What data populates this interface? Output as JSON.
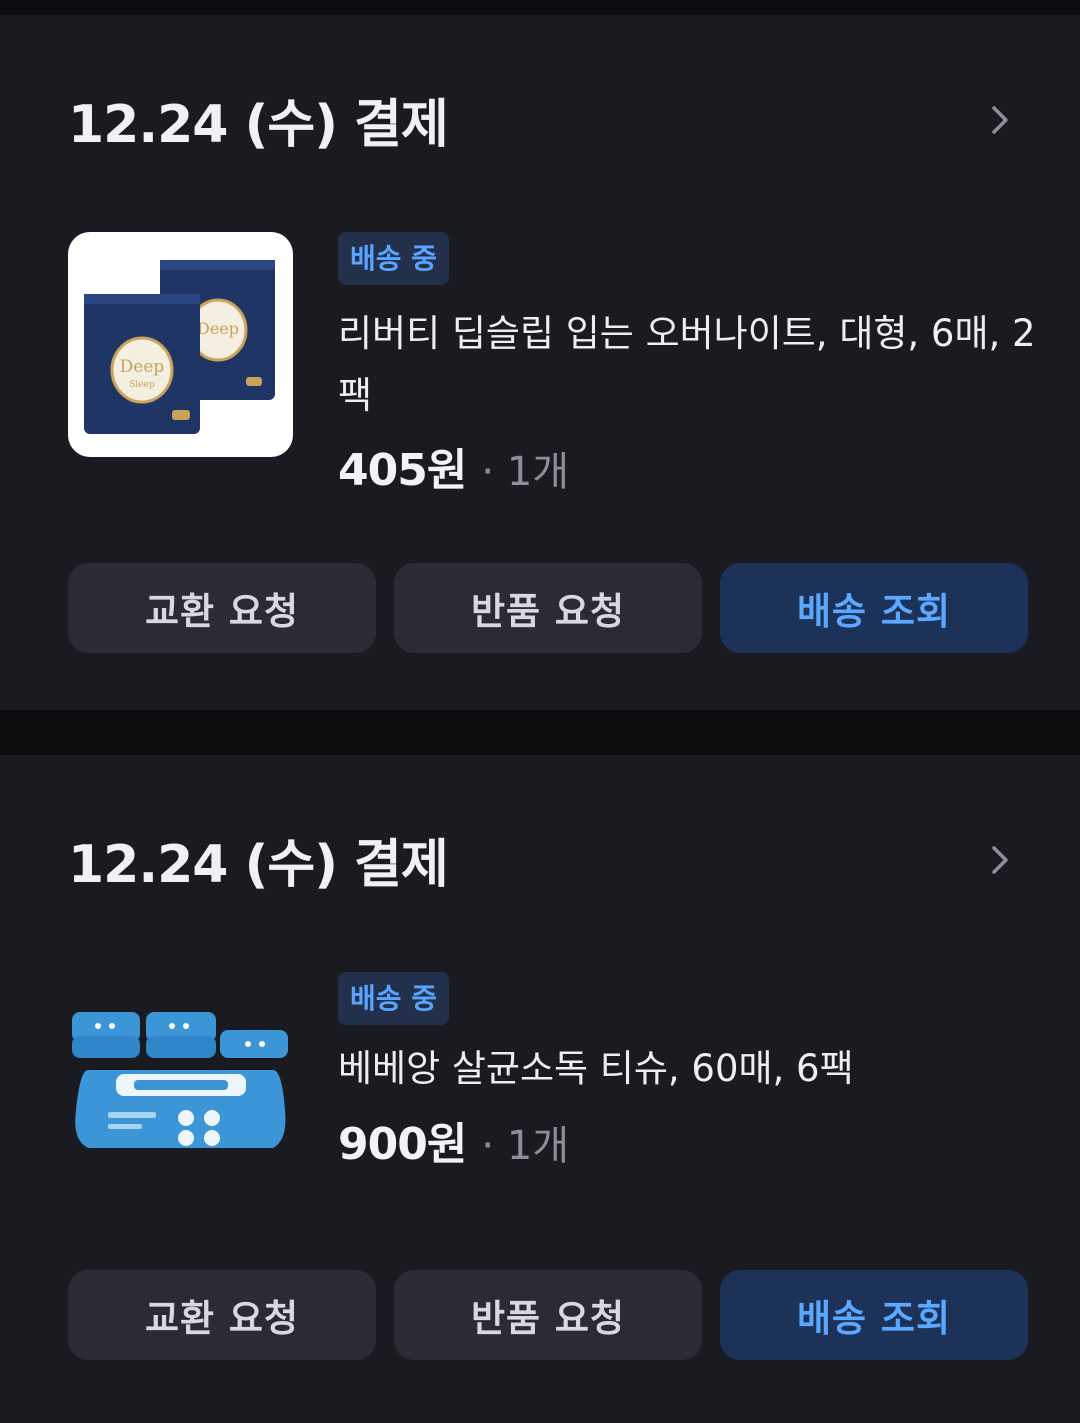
{
  "orders": [
    {
      "date": "12.24 (수) 결제",
      "status": "배송 중",
      "product_name": "리버티 딥슬립 입는 오버나이트, 대형, 6매, 2팩",
      "price": "405원",
      "quantity": "· 1개",
      "buttons": {
        "exchange": "교환 요청",
        "return": "반품 요청",
        "track": "배송 조회"
      },
      "image_icon": "pad-package-image"
    },
    {
      "date": "12.24 (수) 결제",
      "status": "배송 중",
      "product_name": "베베앙 살균소독 티슈, 60매, 6팩",
      "price": "900원",
      "quantity": "· 1개",
      "buttons": {
        "exchange": "교환 요청",
        "return": "반품 요청",
        "track": "배송 조회"
      },
      "image_icon": "wet-wipes-package-image"
    }
  ],
  "colors": {
    "background": "#0c0c0f",
    "card": "#1a1b21",
    "badge_bg": "#22304c",
    "accent_blue": "#5aa8ff",
    "button_bg": "#2b2c33",
    "track_button_bg": "#1d3258"
  }
}
